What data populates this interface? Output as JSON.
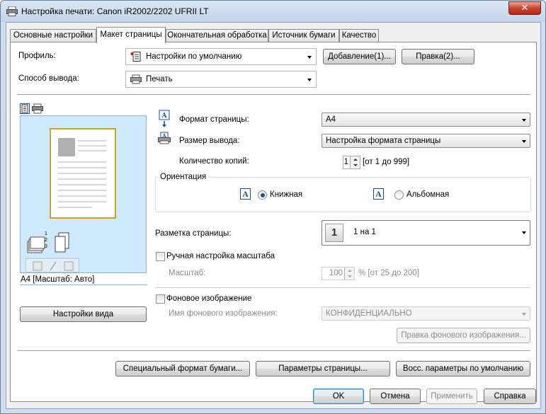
{
  "window": {
    "title": "Настройка печати: Canon iR2002/2202 UFRII LT",
    "close_glyph": "✕"
  },
  "tabs": [
    {
      "label": "Основные настройки"
    },
    {
      "label": "Макет страницы"
    },
    {
      "label": "Окончательная обработка"
    },
    {
      "label": "Источник бумаги"
    },
    {
      "label": "Качество"
    }
  ],
  "profile": {
    "label": "Профиль:",
    "value": "Настройки по умолчанию",
    "add_button": "Добавление(1)...",
    "edit_button": "Правка(2)..."
  },
  "output_method": {
    "label": "Способ вывода:",
    "value": "Печать"
  },
  "preview": {
    "status": "A4 [Масштаб: Авто]",
    "view_settings_button": "Настройки вида",
    "collate_numbers": "1 2 3"
  },
  "page_size": {
    "label": "Формат страницы:",
    "value": "A4"
  },
  "output_size": {
    "label": "Размер вывода:",
    "value": "Настройка формата страницы"
  },
  "copies": {
    "label": "Количество копий:",
    "value": "1",
    "range": "[от 1 до 999]"
  },
  "orientation": {
    "label": "Ориентация",
    "portrait": "Книжная",
    "landscape": "Альбомная",
    "icon_letter": "A"
  },
  "layout": {
    "label": "Разметка страницы:",
    "value": "1 на 1",
    "icon_text": "1"
  },
  "manual_scaling": {
    "label": "Ручная настройка масштаба",
    "scale_label": "Масштаб:",
    "scale_value": "100",
    "scale_range": "% [от 25 до 200]"
  },
  "watermark": {
    "label": "Фоновое изображение",
    "name_label": "Имя фонового изображения:",
    "name_value": "КОНФИДЕНЦИАЛЬНО",
    "edit_button": "Правка фонового изображения..."
  },
  "bottom_buttons": {
    "custom_paper": "Специальный формат бумаги...",
    "page_options": "Параметры страницы...",
    "restore_defaults": "Восс. параметры по умолчанию"
  },
  "dialog_buttons": {
    "ok": "OK",
    "cancel": "Отмена",
    "apply": "Применить",
    "help": "Справка"
  }
}
